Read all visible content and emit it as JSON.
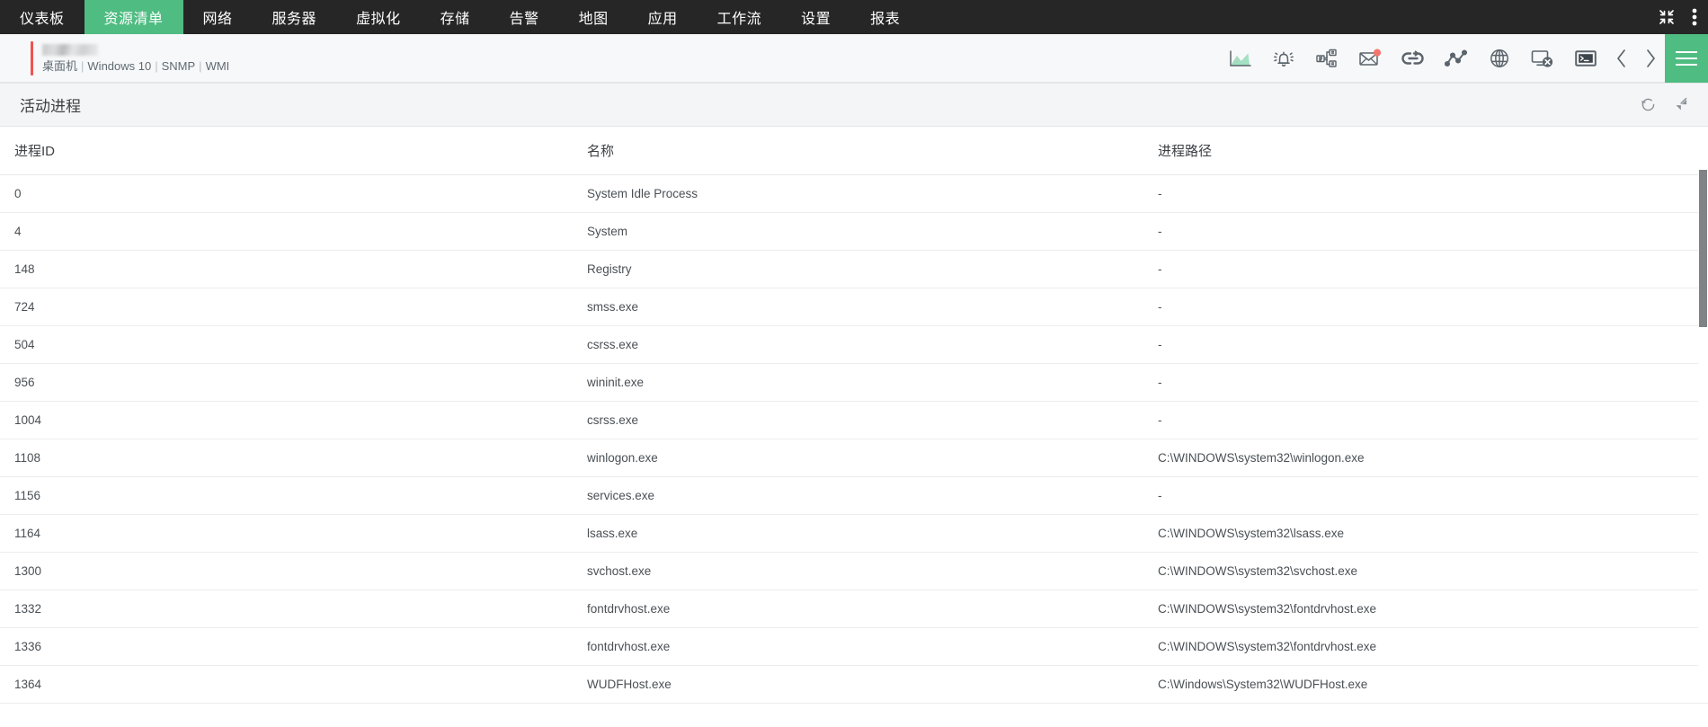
{
  "topnav": {
    "tabs": [
      {
        "label": "仪表板",
        "name": "tab-dashboard",
        "active": false
      },
      {
        "label": "资源清单",
        "name": "tab-inventory",
        "active": true
      },
      {
        "label": "网络",
        "name": "tab-network",
        "active": false
      },
      {
        "label": "服务器",
        "name": "tab-server",
        "active": false
      },
      {
        "label": "虚拟化",
        "name": "tab-virtualization",
        "active": false
      },
      {
        "label": "存储",
        "name": "tab-storage",
        "active": false
      },
      {
        "label": "告警",
        "name": "tab-alarm",
        "active": false
      },
      {
        "label": "地图",
        "name": "tab-map",
        "active": false
      },
      {
        "label": "应用",
        "name": "tab-application",
        "active": false
      },
      {
        "label": "工作流",
        "name": "tab-workflow",
        "active": false
      },
      {
        "label": "设置",
        "name": "tab-settings",
        "active": false
      },
      {
        "label": "报表",
        "name": "tab-report",
        "active": false
      }
    ],
    "right_icons": [
      {
        "name": "collapse-screen-icon"
      },
      {
        "name": "more-vertical-icon"
      }
    ],
    "active_color": "#4FBC82",
    "background": "#262626"
  },
  "device": {
    "name_redacted": true,
    "type": "桌面机",
    "os": "Windows 10",
    "protocols": [
      "SNMP",
      "WMI"
    ],
    "accent_color": "#ef5350",
    "toolbar": [
      {
        "name": "area-chart-icon",
        "title": "性能图表"
      },
      {
        "name": "bell-alarm-icon",
        "title": "告警"
      },
      {
        "name": "workflow-diagram-icon",
        "title": "工作流"
      },
      {
        "name": "mail-notification-icon",
        "title": "消息",
        "badge": true
      },
      {
        "name": "link-loop-icon",
        "title": "关联"
      },
      {
        "name": "line-chart-icon",
        "title": "趋势"
      },
      {
        "name": "globe-icon",
        "title": "网页"
      },
      {
        "name": "remote-desktop-icon",
        "title": "远程桌面"
      },
      {
        "name": "terminal-console-icon",
        "title": "控制台"
      }
    ],
    "prev_label": "上一个",
    "next_label": "下一个",
    "menu_label": "菜单"
  },
  "panel": {
    "title": "活动进程",
    "actions": [
      {
        "name": "refresh-icon",
        "title": "刷新"
      },
      {
        "name": "expand-icon",
        "title": "展开"
      }
    ]
  },
  "table": {
    "columns": [
      {
        "key": "pid",
        "label": "进程ID"
      },
      {
        "key": "name",
        "label": "名称"
      },
      {
        "key": "path",
        "label": "进程路径"
      }
    ],
    "rows": [
      {
        "pid": "0",
        "name": "System Idle Process",
        "path": "-"
      },
      {
        "pid": "4",
        "name": "System",
        "path": "-"
      },
      {
        "pid": "148",
        "name": "Registry",
        "path": "-"
      },
      {
        "pid": "724",
        "name": "smss.exe",
        "path": "-"
      },
      {
        "pid": "504",
        "name": "csrss.exe",
        "path": "-"
      },
      {
        "pid": "956",
        "name": "wininit.exe",
        "path": "-"
      },
      {
        "pid": "1004",
        "name": "csrss.exe",
        "path": "-"
      },
      {
        "pid": "1108",
        "name": "winlogon.exe",
        "path": "C:\\WINDOWS\\system32\\winlogon.exe"
      },
      {
        "pid": "1156",
        "name": "services.exe",
        "path": "-"
      },
      {
        "pid": "1164",
        "name": "lsass.exe",
        "path": "C:\\WINDOWS\\system32\\lsass.exe"
      },
      {
        "pid": "1300",
        "name": "svchost.exe",
        "path": "C:\\WINDOWS\\system32\\svchost.exe"
      },
      {
        "pid": "1332",
        "name": "fontdrvhost.exe",
        "path": "C:\\WINDOWS\\system32\\fontdrvhost.exe"
      },
      {
        "pid": "1336",
        "name": "fontdrvhost.exe",
        "path": "C:\\WINDOWS\\system32\\fontdrvhost.exe"
      },
      {
        "pid": "1364",
        "name": "WUDFHost.exe",
        "path": "C:\\Windows\\System32\\WUDFHost.exe"
      }
    ]
  },
  "scrollbar": {
    "name": "vertical-scrollbar"
  }
}
